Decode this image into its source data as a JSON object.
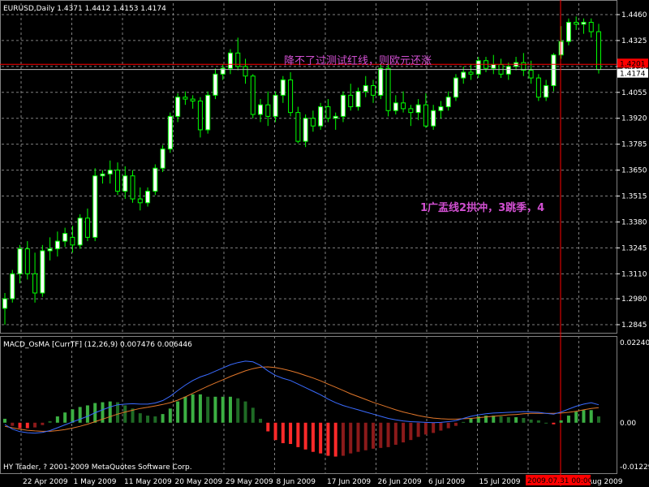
{
  "window": {
    "symbol_header": "EURUSD,Daily  1.4371 1.4412 1.4153 1.4174",
    "annotation_top": "降不了过测试红线，则欧元还涨",
    "annotation_mid": "1广盂线2拱冲，3跳季，4",
    "indicator_header": "MACD_OsMA [CurrTF] (12,26,9) 0.007476 0.006446",
    "copyright": "HY Trader, ? 2001-2009 MetaQuotes Software Corp.",
    "price_tag_red": "1.4201",
    "price_tag_white": "1.4174",
    "date_highlight": "2009.07.31 00:00"
  },
  "colors": {
    "background": "#000000",
    "grid": "#808080",
    "bull_candle": "#ffffff",
    "bear_candle": "#000000",
    "wick": "#00ff00",
    "macd_line": "#3a6bff",
    "signal_line": "#e0762a",
    "hist_pos": "#3cb043",
    "hist_neg": "#ff2a2a",
    "annotation": "#d04fd0",
    "red_line": "#ff0000"
  },
  "price_axis": [
    "1.4460",
    "1.4325",
    "1.4190",
    "1.4055",
    "1.3920",
    "1.3785",
    "1.3650",
    "1.3515",
    "1.3380",
    "1.3245",
    "1.3110",
    "1.2980",
    "1.2845"
  ],
  "indicator_axis": [
    "0.022403",
    "0.00",
    "-0.01229"
  ],
  "date_axis": [
    "22 Apr 2009",
    "1 May 2009",
    "11 May 2009",
    "20 May 2009",
    "29 May 2009",
    "8 Jun 2009",
    "17 Jun 2009",
    "26 Jun 2009",
    "6 Jul 2009",
    "15 Jul 2009",
    "24 Jul 2009",
    "4 Aug 2009"
  ],
  "chart_data": {
    "type": "candlestick",
    "price_ylim": [
      1.2845,
      1.446
    ],
    "horizontal_lines": [
      1.4201,
      1.4174
    ],
    "candles": [
      [
        1.293,
        1.301,
        1.2845,
        1.298
      ],
      [
        1.298,
        1.313,
        1.296,
        1.311
      ],
      [
        1.311,
        1.326,
        1.306,
        1.324
      ],
      [
        1.324,
        1.328,
        1.308,
        1.311
      ],
      [
        1.311,
        1.322,
        1.296,
        1.301
      ],
      [
        1.301,
        1.326,
        1.299,
        1.323
      ],
      [
        1.323,
        1.33,
        1.318,
        1.324
      ],
      [
        1.324,
        1.333,
        1.32,
        1.328
      ],
      [
        1.328,
        1.335,
        1.325,
        1.332
      ],
      [
        1.33,
        1.336,
        1.322,
        1.326
      ],
      [
        1.326,
        1.342,
        1.324,
        1.34
      ],
      [
        1.34,
        1.345,
        1.328,
        1.33
      ],
      [
        1.33,
        1.366,
        1.328,
        1.362
      ],
      [
        1.362,
        1.365,
        1.358,
        1.363
      ],
      [
        1.363,
        1.37,
        1.358,
        1.365
      ],
      [
        1.365,
        1.369,
        1.352,
        1.354
      ],
      [
        1.354,
        1.367,
        1.35,
        1.362
      ],
      [
        1.362,
        1.365,
        1.348,
        1.35
      ],
      [
        1.35,
        1.356,
        1.344,
        1.348
      ],
      [
        1.348,
        1.356,
        1.346,
        1.354
      ],
      [
        1.354,
        1.368,
        1.352,
        1.366
      ],
      [
        1.366,
        1.378,
        1.364,
        1.376
      ],
      [
        1.376,
        1.395,
        1.374,
        1.393
      ],
      [
        1.393,
        1.405,
        1.39,
        1.403
      ],
      [
        1.403,
        1.406,
        1.399,
        1.402
      ],
      [
        1.402,
        1.404,
        1.397,
        1.401
      ],
      [
        1.401,
        1.403,
        1.382,
        1.386
      ],
      [
        1.386,
        1.406,
        1.384,
        1.404
      ],
      [
        1.404,
        1.418,
        1.402,
        1.415
      ],
      [
        1.415,
        1.42,
        1.412,
        1.418
      ],
      [
        1.418,
        1.428,
        1.415,
        1.426
      ],
      [
        1.426,
        1.434,
        1.417,
        1.419
      ],
      [
        1.419,
        1.423,
        1.41,
        1.414
      ],
      [
        1.414,
        1.415,
        1.392,
        1.394
      ],
      [
        1.394,
        1.402,
        1.39,
        1.399
      ],
      [
        1.399,
        1.406,
        1.388,
        1.393
      ],
      [
        1.393,
        1.406,
        1.39,
        1.404
      ],
      [
        1.404,
        1.414,
        1.4,
        1.412
      ],
      [
        1.412,
        1.416,
        1.393,
        1.395
      ],
      [
        1.395,
        1.398,
        1.379,
        1.38
      ],
      [
        1.38,
        1.394,
        1.377,
        1.392
      ],
      [
        1.392,
        1.396,
        1.385,
        1.388
      ],
      [
        1.388,
        1.4,
        1.386,
        1.398
      ],
      [
        1.398,
        1.402,
        1.39,
        1.392
      ],
      [
        1.392,
        1.395,
        1.386,
        1.393
      ],
      [
        1.393,
        1.406,
        1.39,
        1.404
      ],
      [
        1.404,
        1.41,
        1.396,
        1.398
      ],
      [
        1.398,
        1.408,
        1.396,
        1.406
      ],
      [
        1.406,
        1.414,
        1.403,
        1.409
      ],
      [
        1.409,
        1.412,
        1.4,
        1.404
      ],
      [
        1.404,
        1.42,
        1.402,
        1.418
      ],
      [
        1.418,
        1.42,
        1.393,
        1.396
      ],
      [
        1.396,
        1.404,
        1.394,
        1.4
      ],
      [
        1.4,
        1.406,
        1.395,
        1.397
      ],
      [
        1.397,
        1.399,
        1.388,
        1.395
      ],
      [
        1.395,
        1.402,
        1.391,
        1.399
      ],
      [
        1.399,
        1.405,
        1.387,
        1.388
      ],
      [
        1.388,
        1.399,
        1.386,
        1.396
      ],
      [
        1.396,
        1.401,
        1.392,
        1.398
      ],
      [
        1.398,
        1.406,
        1.396,
        1.403
      ],
      [
        1.403,
        1.415,
        1.401,
        1.413
      ],
      [
        1.413,
        1.419,
        1.41,
        1.416
      ],
      [
        1.416,
        1.42,
        1.412,
        1.415
      ],
      [
        1.415,
        1.424,
        1.413,
        1.422
      ],
      [
        1.422,
        1.424,
        1.416,
        1.418
      ],
      [
        1.418,
        1.425,
        1.415,
        1.42
      ],
      [
        1.42,
        1.423,
        1.413,
        1.415
      ],
      [
        1.415,
        1.421,
        1.412,
        1.419
      ],
      [
        1.419,
        1.424,
        1.417,
        1.421
      ],
      [
        1.421,
        1.426,
        1.414,
        1.417
      ],
      [
        1.417,
        1.422,
        1.41,
        1.413
      ],
      [
        1.413,
        1.415,
        1.401,
        1.403
      ],
      [
        1.403,
        1.412,
        1.401,
        1.409
      ],
      [
        1.409,
        1.426,
        1.406,
        1.425
      ],
      [
        1.425,
        1.44,
        1.423,
        1.432
      ],
      [
        1.432,
        1.444,
        1.43,
        1.442
      ],
      [
        1.442,
        1.445,
        1.438,
        1.441
      ],
      [
        1.441,
        1.444,
        1.436,
        1.442
      ],
      [
        1.442,
        1.444,
        1.434,
        1.4371
      ],
      [
        1.4371,
        1.4412,
        1.4153,
        1.4174
      ]
    ],
    "macd": [
      -0.0005,
      -0.0018,
      -0.0025,
      -0.0028,
      -0.0029,
      -0.0027,
      -0.0022,
      -0.0014,
      -0.0006,
      0.0002,
      0.001,
      0.0018,
      0.0028,
      0.0036,
      0.0044,
      0.005,
      0.0052,
      0.0053,
      0.0052,
      0.0052,
      0.0055,
      0.0062,
      0.0074,
      0.009,
      0.0105,
      0.0118,
      0.0128,
      0.0135,
      0.0144,
      0.0153,
      0.0162,
      0.0168,
      0.0172,
      0.017,
      0.016,
      0.0145,
      0.0132,
      0.0124,
      0.0118,
      0.0108,
      0.0098,
      0.0088,
      0.0078,
      0.0066,
      0.0056,
      0.0048,
      0.0042,
      0.0036,
      0.003,
      0.0024,
      0.0018,
      0.0012,
      0.0008,
      0.0005,
      0.0003,
      0.0002,
      0.0001,
      0.0,
      0.0001,
      0.0003,
      0.0006,
      0.0012,
      0.0018,
      0.0022,
      0.0025,
      0.0027,
      0.0028,
      0.0029,
      0.003,
      0.0031,
      0.003,
      0.0029,
      0.0026,
      0.0024,
      0.003,
      0.0038,
      0.0046,
      0.0052,
      0.0056,
      0.005
    ],
    "signal": [
      -0.001,
      -0.0014,
      -0.0018,
      -0.0021,
      -0.0023,
      -0.0024,
      -0.0024,
      -0.0022,
      -0.0019,
      -0.0015,
      -0.001,
      -0.0004,
      0.0003,
      0.001,
      0.0017,
      0.0024,
      0.003,
      0.0035,
      0.004,
      0.0043,
      0.0047,
      0.0051,
      0.0056,
      0.0063,
      0.0072,
      0.0082,
      0.0092,
      0.0102,
      0.0111,
      0.012,
      0.0129,
      0.0137,
      0.0145,
      0.0151,
      0.0155,
      0.0156,
      0.0154,
      0.015,
      0.0145,
      0.0139,
      0.0132,
      0.0125,
      0.0117,
      0.0108,
      0.0099,
      0.009,
      0.0081,
      0.0073,
      0.0065,
      0.0057,
      0.005,
      0.0043,
      0.0036,
      0.003,
      0.0025,
      0.002,
      0.0016,
      0.0013,
      0.0011,
      0.001,
      0.001,
      0.0011,
      0.0012,
      0.0014,
      0.0016,
      0.0018,
      0.002,
      0.0022,
      0.0023,
      0.0025,
      0.0026,
      0.0026,
      0.0026,
      0.0026,
      0.0027,
      0.0029,
      0.0032,
      0.0036,
      0.004,
      0.0042
    ],
    "indicator_ylim": [
      -0.01229,
      0.022403
    ]
  }
}
